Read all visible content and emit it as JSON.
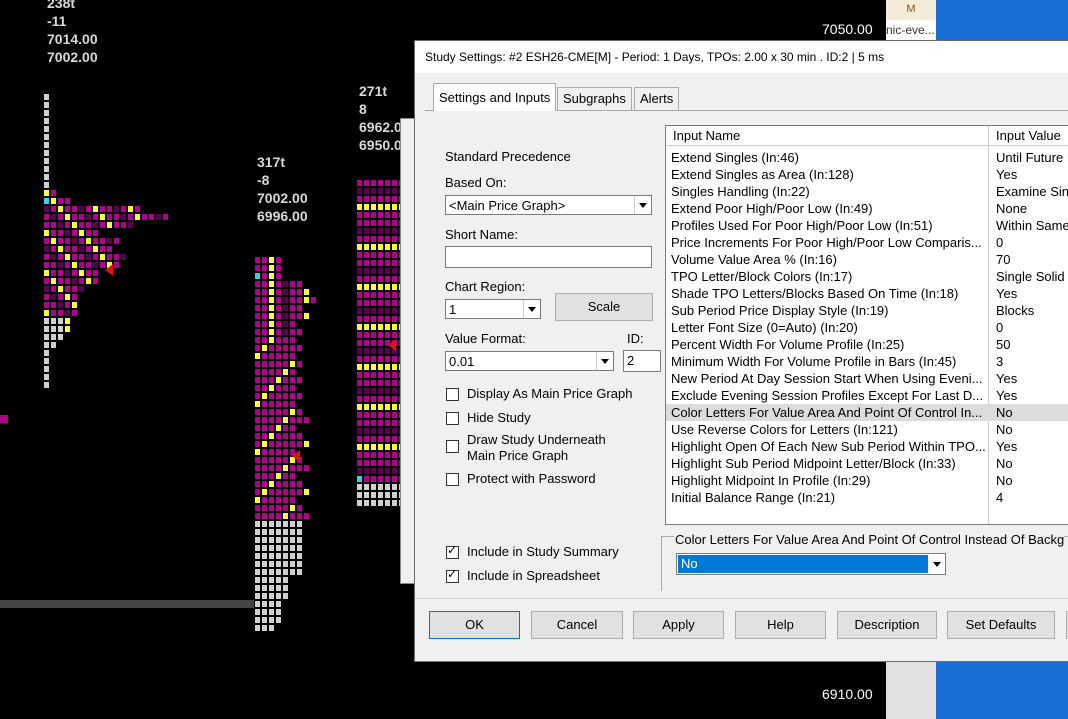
{
  "chart": {
    "left_profile_labels": [
      "238t",
      "-11",
      "7014.00",
      "7002.00"
    ],
    "mid_profile_labels": [
      "317t",
      "-8",
      "7002.00",
      "6996.00"
    ],
    "right_profile_labels": [
      "271t",
      "8",
      "6962.0",
      "6950.0"
    ],
    "price_top": "7050.00",
    "price_bottom": "6910.00",
    "colors": {
      "magenta": "#b0008c",
      "dark_purple": "#5a0050",
      "yellow": "#ffff33",
      "light_gray": "#d0d0d0",
      "cyan": "#33d6e0",
      "red_marker": "#e01010"
    }
  },
  "taskbar": {
    "letter": "M",
    "label": "nic-eve..."
  },
  "dialog": {
    "title": "Study Settings: #2 ESH26-CME[M] - Period: 1 Days, TPOs: 2.00 x 30 min  . ID:2 | 5 ms",
    "tabs": [
      "Settings and Inputs",
      "Subgraphs",
      "Alerts"
    ],
    "precedence": "Standard Precedence",
    "based_on_label": "Based On:",
    "based_on_value": "<Main Price Graph>",
    "short_name_label": "Short Name:",
    "short_name_value": "",
    "chart_region_label": "Chart Region:",
    "chart_region_value": "1",
    "scale_button": "Scale",
    "value_format_label": "Value Format:",
    "value_format_value": "0.01",
    "id_label": "ID:",
    "id_value": "2",
    "checkboxes": [
      {
        "label": "Display As Main Price Graph",
        "checked": false
      },
      {
        "label": "Hide Study",
        "checked": false
      },
      {
        "label": "Draw Study Underneath\nMain Price Graph",
        "checked": false
      },
      {
        "label": "Protect with Password",
        "checked": false
      },
      {
        "label": "Include in Study Summary",
        "checked": true
      },
      {
        "label": "Include in Spreadsheet",
        "checked": true
      }
    ],
    "grid": {
      "col_name": "Input Name",
      "col_value": "Input Value",
      "rows": [
        {
          "name": "Extend Singles   (In:46)",
          "value": "Until Future I"
        },
        {
          "name": "Extend Singles as Area   (In:128)",
          "value": "Yes"
        },
        {
          "name": "Singles Handling   (In:22)",
          "value": "Examine Sin"
        },
        {
          "name": "Extend Poor High/Poor Low   (In:49)",
          "value": "None"
        },
        {
          "name": "Profiles Used For Poor High/Poor Low   (In:51)",
          "value": "Within Same"
        },
        {
          "name": "Price Increments For Poor High/Poor Low Comparis...",
          "value": "0"
        },
        {
          "name": "Volume Value Area %   (In:16)",
          "value": "70"
        },
        {
          "name": "TPO Letter/Block Colors   (In:17)",
          "value": "Single Solid"
        },
        {
          "name": "Shade TPO Letters/Blocks Based On Time   (In:18)",
          "value": "Yes"
        },
        {
          "name": "Sub Period Price Display Style   (In:19)",
          "value": "Blocks"
        },
        {
          "name": "Letter Font Size (0=Auto)   (In:20)",
          "value": "0"
        },
        {
          "name": "Percent Width For Volume Profile   (In:25)",
          "value": "50"
        },
        {
          "name": "Minimum Width For Volume Profile in Bars   (In:45)",
          "value": "3"
        },
        {
          "name": "New Period At Day Session Start When Using Eveni...",
          "value": "Yes"
        },
        {
          "name": "Exclude Evening Session Profiles Except For Last D...",
          "value": "Yes"
        },
        {
          "name": "Color Letters For Value Area And Point Of Control In...",
          "value": "No",
          "selected": true
        },
        {
          "name": "Use Reverse Colors for Letters   (In:121)",
          "value": "No"
        },
        {
          "name": "Highlight Open Of Each New Sub Period Within TPO...",
          "value": "Yes"
        },
        {
          "name": "Highlight Sub Period Midpoint Letter/Block   (In:33)",
          "value": "No"
        },
        {
          "name": "Highlight Midpoint In Profile   (In:29)",
          "value": "No"
        },
        {
          "name": "Initial Balance Range   (In:21)",
          "value": "4"
        }
      ]
    },
    "description_label": "Color Letters For Value Area And Point Of Control Instead Of Backg",
    "description_value": "No",
    "buttons": [
      "OK",
      "Cancel",
      "Apply",
      "Help",
      "Description",
      "Set Defaults"
    ]
  }
}
